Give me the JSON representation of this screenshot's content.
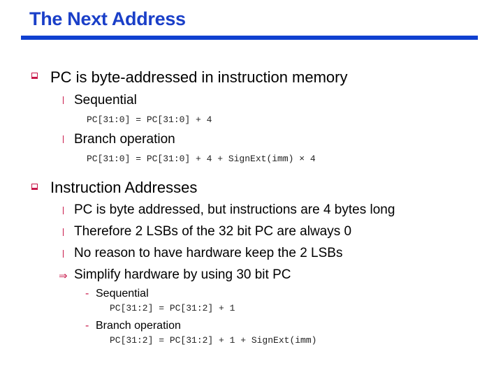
{
  "slide": {
    "title": "The Next Address",
    "accent_color": "#1a3fc8",
    "bullet_color": "#c8184a",
    "sections": [
      {
        "heading": "PC is byte-addressed in instruction memory",
        "items": [
          {
            "label": "Sequential",
            "code": "PC[31:0] = PC[31:0] + 4"
          },
          {
            "label": "Branch operation",
            "code": "PC[31:0] = PC[31:0] + 4 + SignExt(imm) × 4"
          }
        ]
      },
      {
        "heading": "Instruction Addresses",
        "items": [
          {
            "label": "PC is byte addressed, but instructions are 4 bytes long"
          },
          {
            "label": "Therefore 2 LSBs of the 32 bit PC are always 0"
          },
          {
            "label": "No reason to have hardware keep the 2 LSBs"
          }
        ],
        "implication": {
          "arrow": "⇒",
          "label": "Simplify hardware by using 30 bit PC",
          "subitems": [
            {
              "dash": "-",
              "label": "Sequential",
              "code": "PC[31:2] = PC[31:2] + 1"
            },
            {
              "dash": "-",
              "label": "Branch operation",
              "code": "PC[31:2] = PC[31:2] + 1 + SignExt(imm)"
            }
          ]
        }
      }
    ]
  }
}
